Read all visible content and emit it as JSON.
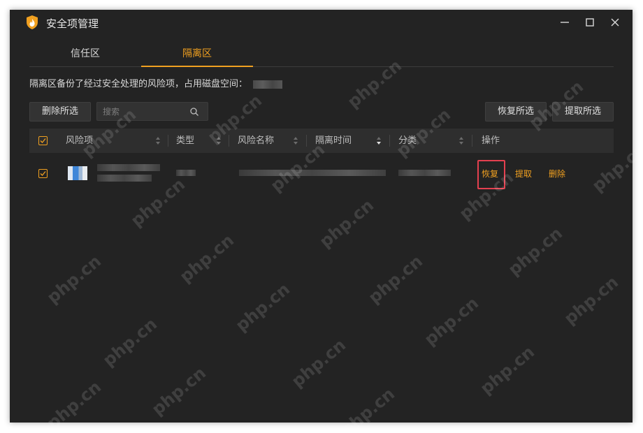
{
  "window": {
    "title": "安全项管理",
    "controls": [
      "minimize-icon",
      "maximize-icon",
      "close-icon"
    ]
  },
  "tabs": [
    {
      "label": "信任区",
      "active": false
    },
    {
      "label": "隔离区",
      "active": true
    }
  ],
  "info": {
    "text": "隔离区备份了经过安全处理的风险项，占用磁盘空间："
  },
  "toolbar": {
    "delete_selected": "删除所选",
    "search_placeholder": "搜索",
    "restore_selected": "恢复所选",
    "extract_selected": "提取所选"
  },
  "table": {
    "columns": [
      "风险项",
      "类型",
      "风险名称",
      "隔离时间",
      "分类",
      "操作"
    ],
    "select_all_checked": true,
    "rows": [
      {
        "checked": true,
        "actions": {
          "restore": "恢复",
          "extract": "提取",
          "delete": "删除"
        }
      }
    ]
  },
  "watermark": "php.cn",
  "colors": {
    "background": "#232323",
    "accent": "#f0a020",
    "highlight": "#e4404f"
  }
}
